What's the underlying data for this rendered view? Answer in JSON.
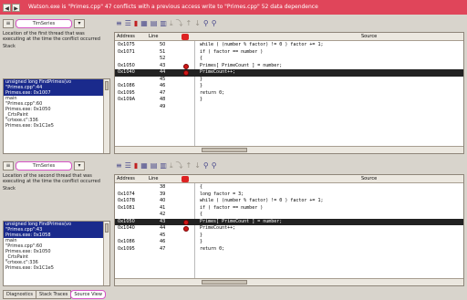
{
  "window": {
    "title": "Watson.exe is \"Primes.cpp\" 47 conflicts with a previous access write to \"Primes.cpp\" 52 data dependence",
    "nav": [
      "◀",
      "▶"
    ]
  },
  "panes": [
    {
      "thread_label": "TimSeries",
      "description": "Location of the first thread that was executing at the time the conflict occurred",
      "stack_label": "Stack",
      "stack": [
        {
          "text": "unsigned long FindPrimes(vo",
          "sel": true
        },
        {
          "text": "\"Primes.cpp\":44",
          "sel": true
        },
        {
          "text": "Primes.exe: 0x1007",
          "sel": true
        },
        {
          "text": "main",
          "sel": false
        },
        {
          "text": "\"Primes.cpp\":60",
          "sel": false
        },
        {
          "text": "Primes.exe: 0x1050",
          "sel": false
        },
        {
          "text": "_CrtsPaint",
          "sel": false
        },
        {
          "text": "\"crtexe.c\":336",
          "sel": false
        },
        {
          "text": "Primes.exe: 0x1C1e5",
          "sel": false
        }
      ],
      "header": {
        "address": "Address",
        "line": "Line",
        "source": "Source"
      },
      "rows": [
        {
          "addr": "0x1075",
          "line": "50",
          "bp": false,
          "src": "while ( (number % factor) != 0 ) factor += 1;",
          "hl": false
        },
        {
          "addr": "0x1071",
          "line": "51",
          "bp": false,
          "src": "if ( factor == number )",
          "hl": false
        },
        {
          "addr": "",
          "line": "52",
          "bp": false,
          "src": "{",
          "hl": false
        },
        {
          "addr": "0x1050",
          "line": "43",
          "bp": true,
          "src": "Primes[ PrimeCount ] = number;",
          "hl": false
        },
        {
          "addr": "0x1040",
          "line": "44",
          "bp": true,
          "src": "PrimeCount++;",
          "hl": true
        },
        {
          "addr": "",
          "line": "45",
          "bp": false,
          "src": "}",
          "hl": false
        },
        {
          "addr": "0x1086",
          "line": "46",
          "bp": false,
          "src": "}",
          "hl": false
        },
        {
          "addr": "0x1095",
          "line": "47",
          "bp": false,
          "src": "return 0;",
          "hl": false
        },
        {
          "addr": "0x109A",
          "line": "48",
          "bp": false,
          "src": "}",
          "hl": false
        },
        {
          "addr": "",
          "line": "49",
          "bp": false,
          "src": "",
          "hl": false
        }
      ]
    },
    {
      "thread_label": "TimSeries",
      "description": "Location of the second thread that was executing at the time the conflict occurred",
      "stack_label": "Stack",
      "stack": [
        {
          "text": "unsigned long FindPrimes(vo",
          "sel": true
        },
        {
          "text": "\"Primes.cpp\":43",
          "sel": true
        },
        {
          "text": "Primes.exe: 0x1058",
          "sel": true
        },
        {
          "text": "main",
          "sel": false
        },
        {
          "text": "\"Primes.cpp\":60",
          "sel": false
        },
        {
          "text": "Primes.exe: 0x1050",
          "sel": false
        },
        {
          "text": "_CrtsPaint",
          "sel": false
        },
        {
          "text": "\"crtexe.c\":336",
          "sel": false
        },
        {
          "text": "Primes.exe: 0x1C1e5",
          "sel": false
        }
      ],
      "header": {
        "address": "Address",
        "line": "Line",
        "source": "Source"
      },
      "rows": [
        {
          "addr": "",
          "line": "38",
          "bp": false,
          "src": "{",
          "hl": false
        },
        {
          "addr": "0x1074",
          "line": "39",
          "bp": false,
          "src": "long factor = 3;",
          "hl": false
        },
        {
          "addr": "0x107B",
          "line": "40",
          "bp": false,
          "src": "while ( (number % factor) != 0 ) factor += 1;",
          "hl": false
        },
        {
          "addr": "0x1081",
          "line": "41",
          "bp": false,
          "src": "if ( factor == number )",
          "hl": false
        },
        {
          "addr": "",
          "line": "42",
          "bp": false,
          "src": "{",
          "hl": false
        },
        {
          "addr": "0x1050",
          "line": "43",
          "bp": true,
          "src": "Primes[ PrimeCount ] = number;",
          "hl": true
        },
        {
          "addr": "0x1040",
          "line": "44",
          "bp": true,
          "src": "PrimeCount++;",
          "hl": false
        },
        {
          "addr": "",
          "line": "45",
          "bp": false,
          "src": "}",
          "hl": false
        },
        {
          "addr": "0x1086",
          "line": "46",
          "bp": false,
          "src": "}",
          "hl": false
        },
        {
          "addr": "0x1095",
          "line": "47",
          "bp": false,
          "src": "return 0;",
          "hl": false
        }
      ]
    }
  ],
  "tabs": [
    {
      "label": "Diagnostics",
      "active": false
    },
    {
      "label": "Stack Traces",
      "active": false
    },
    {
      "label": "Source View",
      "active": true
    }
  ],
  "colors": {
    "title_bg": "#e0455a",
    "highlight": "#d653c6",
    "selection": "#1a2a8c",
    "breakpoint": "#d01818"
  }
}
